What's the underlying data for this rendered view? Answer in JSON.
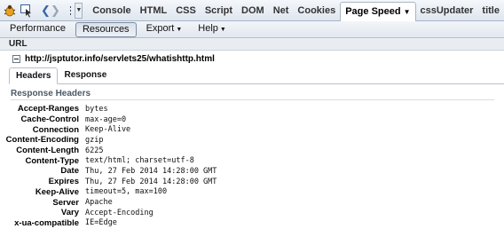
{
  "toolbar": {
    "tabs": [
      {
        "label": "Console",
        "name": "tab-console"
      },
      {
        "label": "HTML",
        "name": "tab-html"
      },
      {
        "label": "CSS",
        "name": "tab-css"
      },
      {
        "label": "Script",
        "name": "tab-script"
      },
      {
        "label": "DOM",
        "name": "tab-dom"
      },
      {
        "label": "Net",
        "name": "tab-net"
      },
      {
        "label": "Cookies",
        "name": "tab-cookies"
      },
      {
        "label": "Page Speed",
        "name": "tab-page-speed",
        "active": true,
        "dropdown": true
      },
      {
        "label": "cssUpdater",
        "name": "tab-cssupdater"
      },
      {
        "label": "title",
        "name": "tab-title"
      }
    ]
  },
  "subbar": {
    "items": [
      {
        "label": "Performance",
        "name": "performance-button"
      },
      {
        "label": "Resources",
        "name": "resources-button",
        "pressed": true
      },
      {
        "label": "Export",
        "name": "export-menu",
        "dropdown": true
      },
      {
        "label": "Help",
        "name": "help-menu",
        "dropdown": true
      }
    ]
  },
  "url_section": {
    "header": "URL",
    "url": "http://jsptutor.info/servlets25/whatishttp.html"
  },
  "inner_tabs": [
    {
      "label": "Headers",
      "name": "tab-headers",
      "active": true
    },
    {
      "label": "Response",
      "name": "tab-response"
    }
  ],
  "response_headers": {
    "title": "Response Headers",
    "rows": [
      {
        "name": "Accept-Ranges",
        "value": "bytes"
      },
      {
        "name": "Cache-Control",
        "value": "max-age=0"
      },
      {
        "name": "Connection",
        "value": "Keep-Alive"
      },
      {
        "name": "Content-Encoding",
        "value": "gzip"
      },
      {
        "name": "Content-Length",
        "value": "6225"
      },
      {
        "name": "Content-Type",
        "value": "text/html; charset=utf-8"
      },
      {
        "name": "Date",
        "value": "Thu, 27 Feb 2014 14:28:00 GMT"
      },
      {
        "name": "Expires",
        "value": "Thu, 27 Feb 2014 14:28:00 GMT"
      },
      {
        "name": "Keep-Alive",
        "value": "timeout=5, max=100"
      },
      {
        "name": "Server",
        "value": "Apache"
      },
      {
        "name": "Vary",
        "value": "Accept-Encoding"
      },
      {
        "name": "x-ua-compatible",
        "value": "IE=Edge"
      }
    ]
  }
}
